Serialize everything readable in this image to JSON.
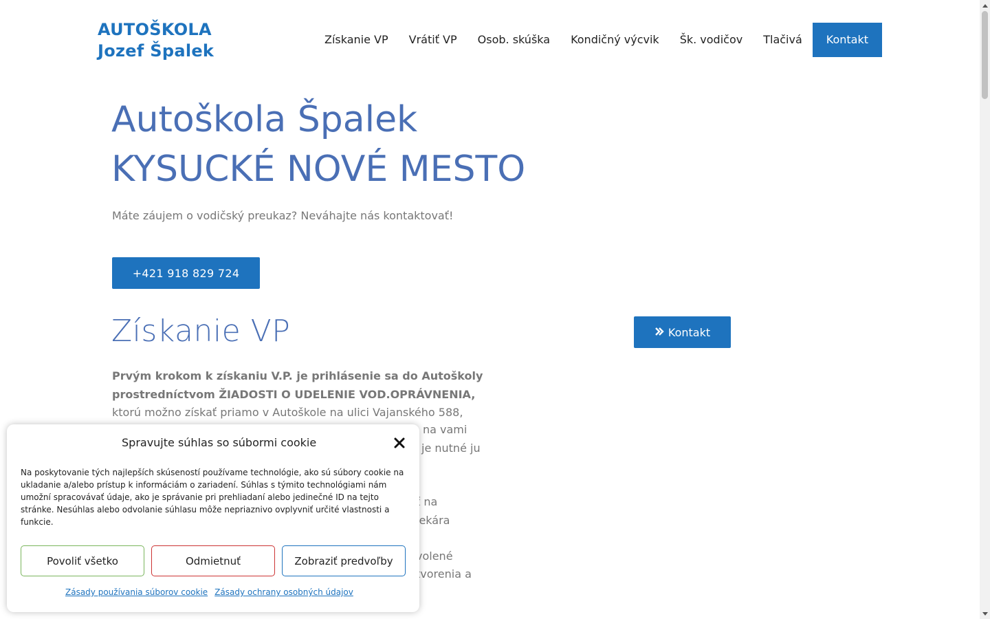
{
  "logo": {
    "line1": "AUTOŠKOLA",
    "line2": "Jozef Špalek"
  },
  "nav": {
    "items": [
      {
        "label": "Získanie VP"
      },
      {
        "label": "Vrátiť VP"
      },
      {
        "label": "Osob. skúška"
      },
      {
        "label": "Kondičný výcvik"
      },
      {
        "label": "Šk. vodičov"
      },
      {
        "label": "Tlačivá"
      }
    ],
    "cta_label": "Kontakt"
  },
  "hero": {
    "title_line1": "Autoškola Špalek",
    "title_line2": "KYSUCKÉ NOVÉ MESTO",
    "subtitle": "Máte záujem o vodičský preukaz? Neváhajte nás kontaktovať!",
    "phone_button": "+421 918 829 724"
  },
  "section": {
    "title": "Získanie VP",
    "kontakt_button": "Kontakt",
    "paragraph_bold_line1": "Prvým krokom k získaniu V.P. je prihlásenie sa do Autoškoly",
    "paragraph_bold_line2": "prostredníctvom ŽIADOSTI O UDELENIE VOD.OPRÁVNENIA,",
    "paragraph_line3": "ktorú možno získať priamo v Autoškole na ulici Vajanského 588,",
    "frag1": "na vami",
    "frag2": "je nutné ju",
    "frag3": "ť na",
    "frag4": "lekára",
    "frag5": "volené",
    "frag6": "tvorenia a"
  },
  "cookie": {
    "title": "Spravujte súhlas so súbormi cookie",
    "text": "Na poskytovanie tých najlepších skúseností používame technológie, ako sú súbory cookie na ukladanie a/alebo prístup k informáciám o zariadení. Súhlas s týmito technológiami nám umožní spracovávať údaje, ako je správanie pri prehliadaní alebo jedinečné ID na tejto stránke. Nesúhlas alebo odvolanie súhlasu môže nepriaznivo ovplyvniť určité vlastnosti a funkcie.",
    "accept_label": "Povoliť všetko",
    "deny_label": "Odmietnuť",
    "prefs_label": "Zobraziť predvoľby",
    "link_cookie_policy": "Zásady používania súborov cookie",
    "link_privacy_policy": "Zásady ochrany osobných údajov"
  },
  "colors": {
    "brand_blue": "#1e73be",
    "heading_blue": "#4a6fb5",
    "text_grey": "#777777",
    "accept_border": "#7ab55c",
    "deny_border": "#cc3333"
  }
}
